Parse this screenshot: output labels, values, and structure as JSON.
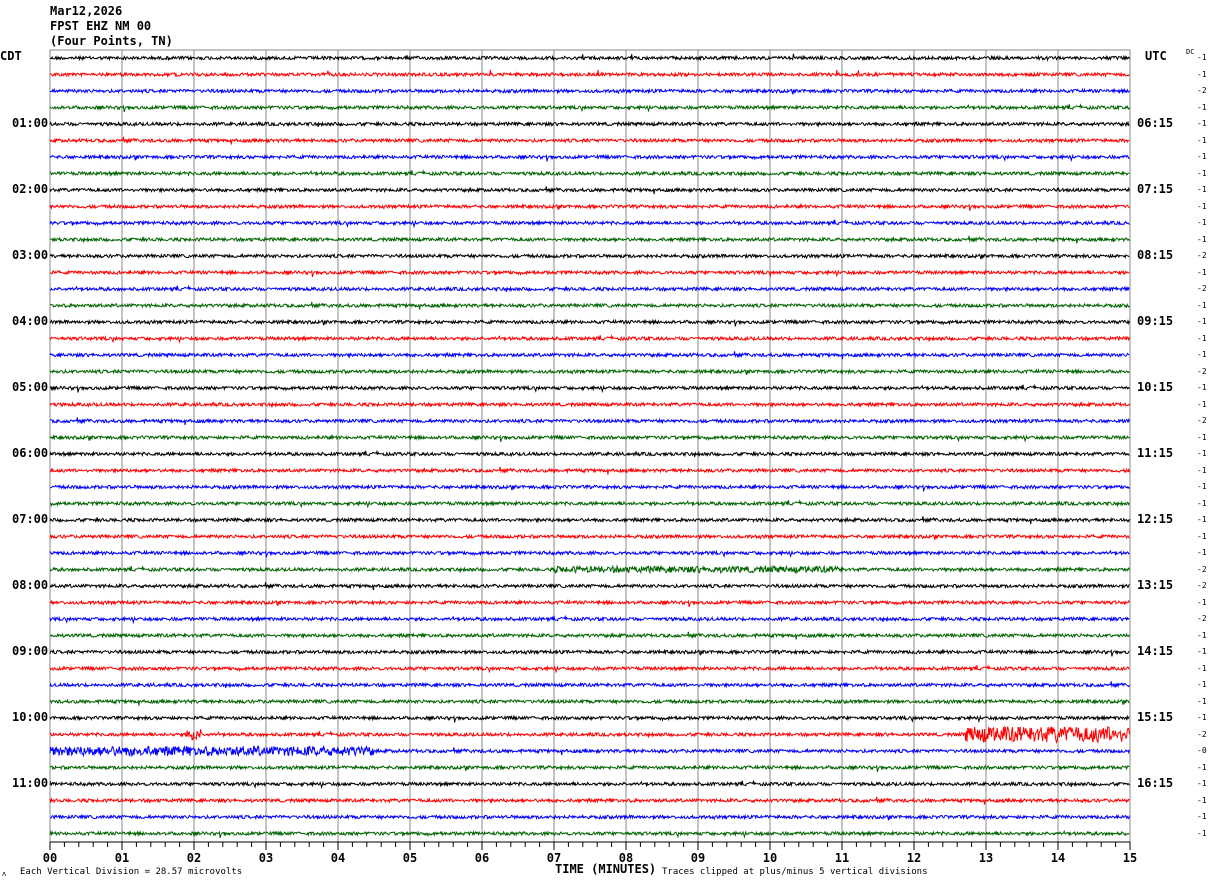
{
  "header": {
    "date": "Mar12,2026",
    "station": "FPST EHZ NM 00",
    "location": "(Four Points, TN)"
  },
  "left_axis": {
    "label": "CDT",
    "hours": [
      "01:00",
      "02:00",
      "03:00",
      "04:00",
      "05:00",
      "06:00",
      "07:00",
      "08:00",
      "09:00",
      "10:00",
      "11:00"
    ]
  },
  "right_axis": {
    "label": "UTC",
    "dc_label": "DC",
    "hours": [
      "06:15",
      "07:15",
      "08:15",
      "09:15",
      "10:15",
      "11:15",
      "12:15",
      "13:15",
      "14:15",
      "15:15",
      "16:15"
    ]
  },
  "footer": {
    "scale_text": "Each Vertical Division =   28.57 microvolts",
    "scale_icon": "ʌ",
    "xlabel": "TIME (MINUTES)",
    "clip_note": "Traces clipped at plus/minus 5 vertical divisions"
  },
  "chart_data": {
    "type": "line",
    "title": "",
    "xlabel": "TIME (MINUTES)",
    "xlim": [
      0,
      15
    ],
    "x_ticks": [
      "00",
      "01",
      "02",
      "03",
      "04",
      "05",
      "06",
      "07",
      "08",
      "09",
      "10",
      "11",
      "12",
      "13",
      "14",
      "15"
    ],
    "minor_tick_interval_minutes": 0.2,
    "grid": true,
    "rows_per_hour": 4,
    "trace_colors": [
      "#000000",
      "#ff0000",
      "#0000ff",
      "#006400"
    ],
    "dc_offsets": [
      -1,
      -1,
      -2,
      -1,
      -1,
      -1,
      -1,
      -1,
      -1,
      -1,
      -1,
      -1,
      -2,
      -1,
      -2,
      -1,
      -1,
      -1,
      -1,
      -2,
      -1,
      -1,
      -2,
      -1,
      -1,
      -1,
      -1,
      -1,
      -1,
      -1,
      -1,
      -2,
      -2,
      -1,
      -2,
      -1,
      -1,
      -1,
      -1,
      -1,
      -1,
      -2,
      0,
      -1,
      -1,
      -1,
      -1,
      -1
    ],
    "bursts": [
      {
        "row": 31,
        "start_min": 7.0,
        "end_min": 11.0,
        "amplitude": 2
      },
      {
        "row": 41,
        "start_min": 12.7,
        "end_min": 15.0,
        "amplitude": 5
      },
      {
        "row": 41,
        "start_min": 1.9,
        "end_min": 2.1,
        "amplitude": 4
      },
      {
        "row": 42,
        "start_min": 0.0,
        "end_min": 4.5,
        "amplitude": 3
      }
    ]
  }
}
